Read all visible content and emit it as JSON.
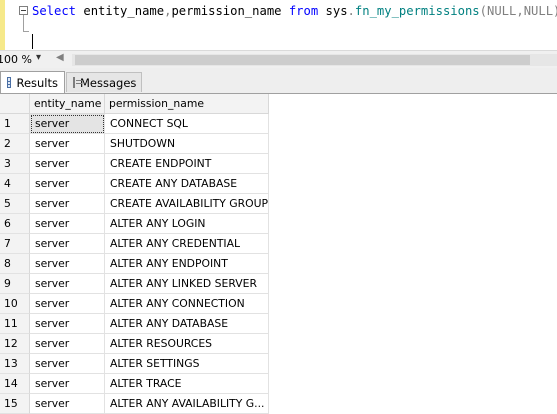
{
  "editor": {
    "query_tokens": [
      {
        "text": "Select ",
        "cls": "kw"
      },
      {
        "text": "entity_name",
        "cls": "ident"
      },
      {
        "text": ",",
        "cls": "punct"
      },
      {
        "text": "permission_name ",
        "cls": "ident"
      },
      {
        "text": "from ",
        "cls": "kw"
      },
      {
        "text": "sys",
        "cls": "ident"
      },
      {
        "text": ".",
        "cls": "punct"
      },
      {
        "text": "fn_my_permissions",
        "cls": "fn"
      },
      {
        "text": "(",
        "cls": "punct"
      },
      {
        "text": "NULL",
        "cls": "punct"
      },
      {
        "text": ",",
        "cls": "punct"
      },
      {
        "text": "NULL",
        "cls": "punct"
      },
      {
        "text": ")",
        "cls": "punct"
      }
    ]
  },
  "zoom": {
    "value": "100 %"
  },
  "tabs": {
    "results_label": "Results",
    "messages_label": "Messages"
  },
  "grid": {
    "columns": [
      "entity_name",
      "permission_name"
    ],
    "rows": [
      {
        "num": "1",
        "entity_name": "server",
        "permission_name": "CONNECT SQL"
      },
      {
        "num": "2",
        "entity_name": "server",
        "permission_name": "SHUTDOWN"
      },
      {
        "num": "3",
        "entity_name": "server",
        "permission_name": "CREATE ENDPOINT"
      },
      {
        "num": "4",
        "entity_name": "server",
        "permission_name": "CREATE ANY DATABASE"
      },
      {
        "num": "5",
        "entity_name": "server",
        "permission_name": "CREATE AVAILABILITY GROUP"
      },
      {
        "num": "6",
        "entity_name": "server",
        "permission_name": "ALTER ANY LOGIN"
      },
      {
        "num": "7",
        "entity_name": "server",
        "permission_name": "ALTER ANY CREDENTIAL"
      },
      {
        "num": "8",
        "entity_name": "server",
        "permission_name": "ALTER ANY ENDPOINT"
      },
      {
        "num": "9",
        "entity_name": "server",
        "permission_name": "ALTER ANY LINKED SERVER"
      },
      {
        "num": "10",
        "entity_name": "server",
        "permission_name": "ALTER ANY CONNECTION"
      },
      {
        "num": "11",
        "entity_name": "server",
        "permission_name": "ALTER ANY DATABASE"
      },
      {
        "num": "12",
        "entity_name": "server",
        "permission_name": "ALTER RESOURCES"
      },
      {
        "num": "13",
        "entity_name": "server",
        "permission_name": "ALTER SETTINGS"
      },
      {
        "num": "14",
        "entity_name": "server",
        "permission_name": "ALTER TRACE"
      },
      {
        "num": "15",
        "entity_name": "server",
        "permission_name": "ALTER ANY AVAILABILITY G..."
      }
    ]
  }
}
